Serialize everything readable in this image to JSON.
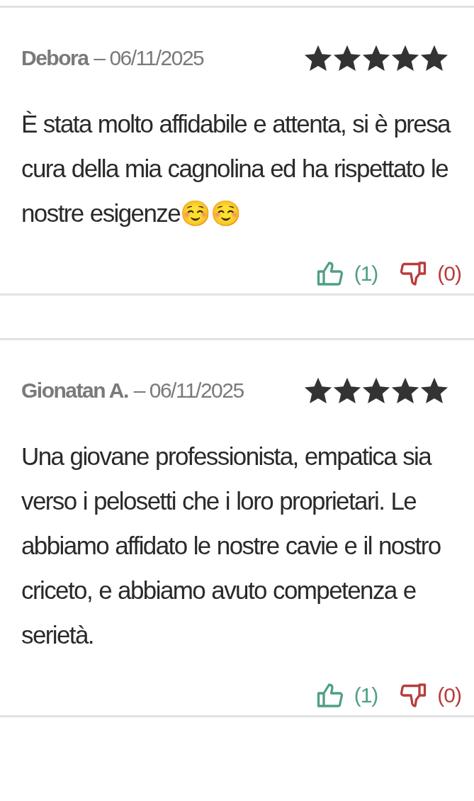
{
  "reviews": [
    {
      "author": "Debora",
      "date": "– 06/11/2025",
      "stars": 5,
      "text": "È stata molto affidabile e attenta, si è presa cura della mia cagnolina ed ha rispettato le nostre esigenze☺️☺️",
      "likes": "(1)",
      "dislikes": "(0)"
    },
    {
      "author": "Gionatan A.",
      "date": "– 06/11/2025",
      "stars": 5,
      "text": "Una giovane professionista, empatica sia verso i pelosetti che i loro proprietari. Le abbiamo affidato le nostre cavie e il nostro criceto, e abbiamo avuto competenza e serietà.",
      "likes": "(1)",
      "dislikes": "(0)"
    }
  ]
}
